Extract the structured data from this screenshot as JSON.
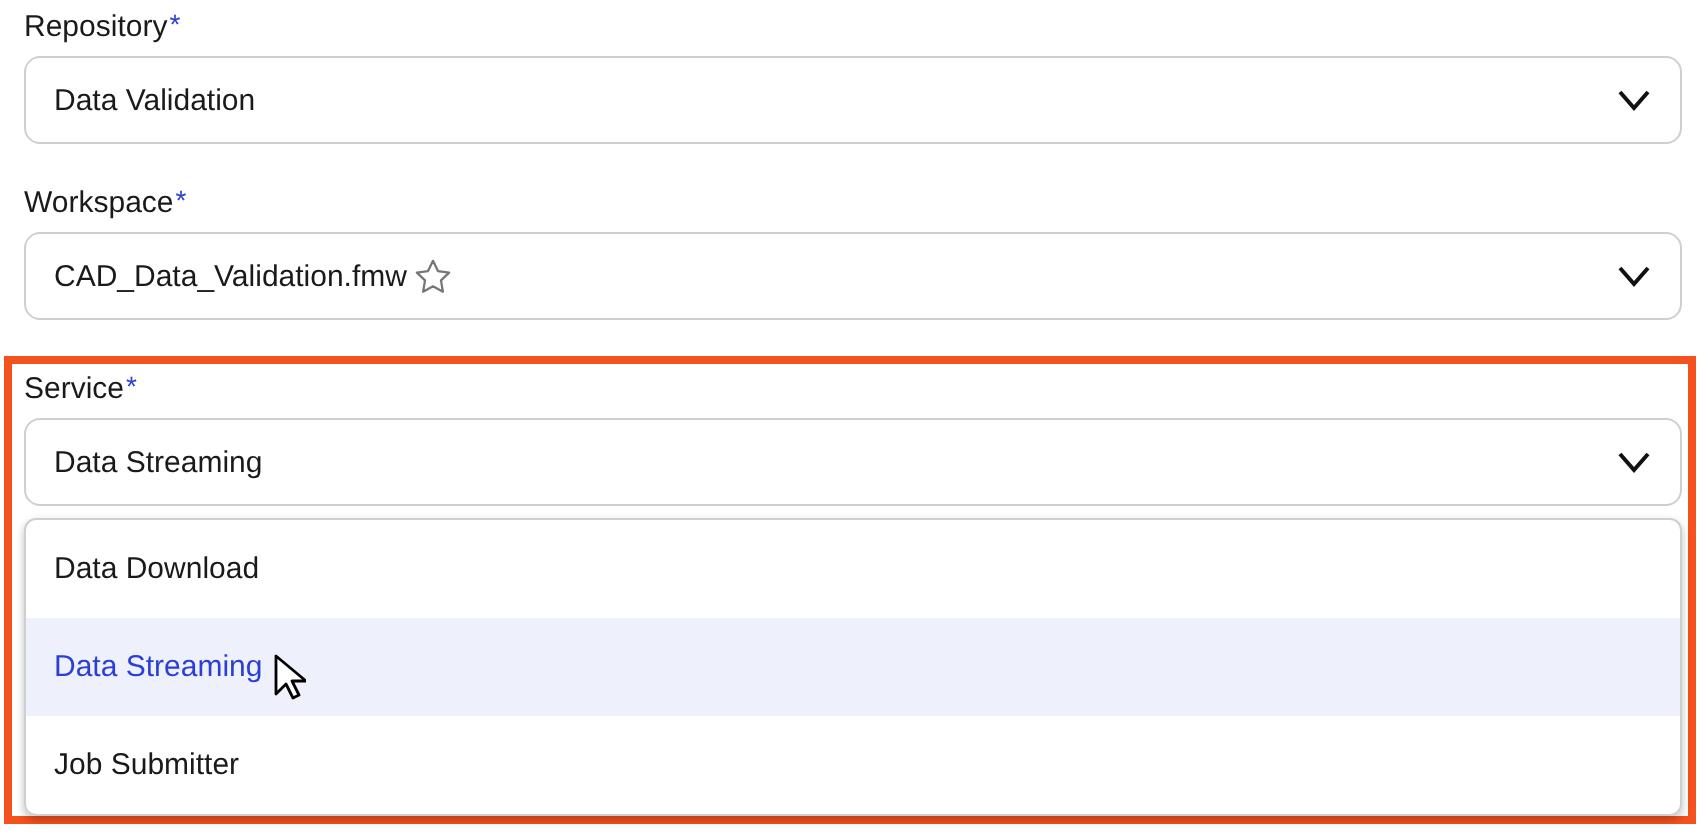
{
  "fields": [
    {
      "label": "Repository",
      "required_mark": "*",
      "value": "Data Validation"
    },
    {
      "label": "Workspace",
      "required_mark": "*",
      "value": "CAD_Data_Validation.fmw",
      "starred": false
    },
    {
      "label": "Service",
      "required_mark": "*",
      "value": "Data Streaming",
      "highlighted": true,
      "expanded": true,
      "options": [
        {
          "label": "Data Download",
          "selected": false
        },
        {
          "label": "Data Streaming",
          "selected": true
        },
        {
          "label": "Job Submitter",
          "selected": false
        }
      ]
    }
  ]
}
